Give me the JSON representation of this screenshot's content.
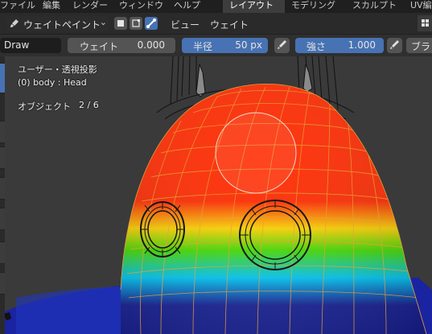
{
  "menubar": {
    "items": [
      "ファイル",
      "編集",
      "レンダー",
      "ウィンドウ",
      "ヘルプ"
    ],
    "workspaces": [
      "レイアウト",
      "モデリング",
      "スカルプト",
      "UV編"
    ],
    "active_workspace": "レイアウト"
  },
  "header": {
    "mode": "ウェイトペイント",
    "menus": [
      "ビュー",
      "ウェイト"
    ]
  },
  "toolbar": {
    "tool_name": "Draw",
    "weight_label": "ウェイト",
    "weight_value": "0.000",
    "radius_label": "半径",
    "radius_value": "50 px",
    "strength_label": "強さ",
    "strength_value": "1.000",
    "brush_label": "ブラ"
  },
  "viewport": {
    "view_name": "ユーザー・透視投影",
    "object_line": "(0) body : Head",
    "objects_label": "オブジェクト",
    "objects_count": "2 / 6"
  },
  "colors": {
    "accent": "#4772b3",
    "weight_high": "#ff2a00",
    "weight_low": "#1a23a0",
    "wire": "#e7a23a"
  },
  "icons": [
    "brush-icon",
    "chevron-down-icon",
    "face-select-icon",
    "vertex-select-icon",
    "bone-select-icon",
    "pen-pressure-icon",
    "grid-icon"
  ]
}
